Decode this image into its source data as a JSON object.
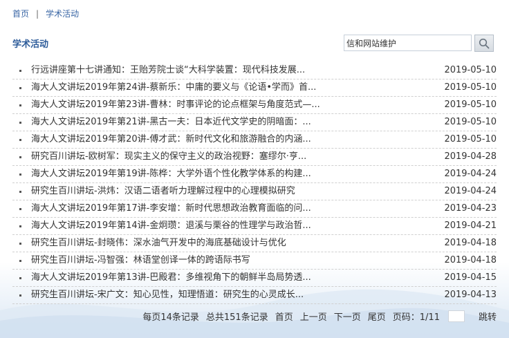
{
  "breadcrumb": {
    "home": "首页",
    "separator": "|",
    "current": "学术活动"
  },
  "section_title": "学术活动",
  "search": {
    "value": "信和网站维护",
    "icon": "search-icon"
  },
  "articles": [
    {
      "title": "行远讲座第十七讲通知：王贻芳院士谈“大科学装置：现代科技发展...",
      "date": "2019-05-10"
    },
    {
      "title": "海大人文讲坛2019年第24讲-蔡新乐：中庸的要义与《论语•学而》首...",
      "date": "2019-05-10"
    },
    {
      "title": "海大人文讲坛2019年第23讲-曹林：时事评论的论点框架与角度范式—...",
      "date": "2019-05-10"
    },
    {
      "title": "海大人文讲坛2019年第21讲-黑古一夫：日本近代文学史的阴暗面：...",
      "date": "2019-05-10"
    },
    {
      "title": "海大人文讲坛2019年第20讲-傅才武：新时代文化和旅游融合的内涵...",
      "date": "2019-05-10"
    },
    {
      "title": "研究百川讲坛-欧树军：现实主义的保守主义的政治视野：塞缪尔·亨...",
      "date": "2019-04-28"
    },
    {
      "title": "海大人文讲坛2019年第19讲-陈桦：大学外语个性化教学体系的构建...",
      "date": "2019-04-24"
    },
    {
      "title": "研究生百川讲坛-洪炜：汉语二语者听力理解过程中的心理模拟研究",
      "date": "2019-04-24"
    },
    {
      "title": "海大人文讲坛2019年第17讲-李安增：新时代思想政治教育面临的问...",
      "date": "2019-04-23"
    },
    {
      "title": "海大人文讲坛2019年第14讲-金炯瓒：退溪与栗谷的性理学与政治哲...",
      "date": "2019-04-21"
    },
    {
      "title": "研究生百川讲坛-封晓伟：深水油气开发中的海底基础设计与优化",
      "date": "2019-04-18"
    },
    {
      "title": "研究生百川讲坛-冯智强：林语堂创译一体的跨语际书写",
      "date": "2019-04-18"
    },
    {
      "title": "海大人文讲坛2019年第13讲-巴殿君：多维视角下的朝鲜半岛局势透...",
      "date": "2019-04-15"
    },
    {
      "title": "研究生百川讲坛-宋广文：知心见性，知理悟道：研究生的心灵成长...",
      "date": "2019-04-13"
    }
  ],
  "pager": {
    "per_page": "每页14条记录",
    "total": "总共151条记录",
    "first": "首页",
    "prev": "上一页",
    "next": "下一页",
    "last": "尾页",
    "page_info": "页码：1/11",
    "go": "跳转"
  }
}
